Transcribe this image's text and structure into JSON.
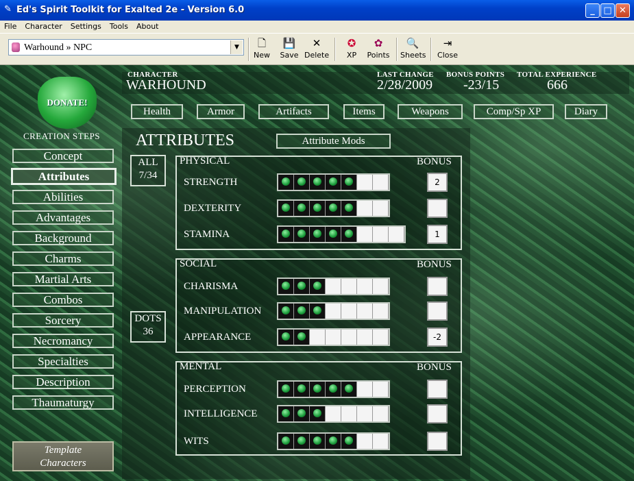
{
  "window": {
    "title": "Ed's Spirit Toolkit for Exalted 2e - Version 6.0",
    "minimize": "_",
    "maximize": "□",
    "close": "✕"
  },
  "menu": [
    "File",
    "Character",
    "Settings",
    "Tools",
    "About"
  ],
  "toolbar": {
    "character_select": "Warhound » NPC",
    "buttons": {
      "new": "New",
      "save": "Save",
      "delete": "Delete",
      "xp": "XP",
      "points": "Points",
      "sheets": "Sheets",
      "close": "Close"
    }
  },
  "sidebar": {
    "donate": "DONATE!",
    "steps_title": "CREATION STEPS",
    "steps": [
      "Concept",
      "Attributes",
      "Abilities",
      "Advantages",
      "Background",
      "Charms",
      "Martial Arts",
      "Combos",
      "Sorcery",
      "Necromancy",
      "Specialties",
      "Description",
      "Thaumaturgy"
    ],
    "active_step": "Attributes",
    "template_line1": "Template",
    "template_line2": "Characters"
  },
  "header": {
    "character_label": "CHARACTER",
    "character_name": "WARHOUND",
    "last_change_label": "LAST CHANGE",
    "last_change": "2/28/2009",
    "bonus_points_label": "BONUS POINTS",
    "bonus_points": "-23/15",
    "total_xp_label": "TOTAL EXPERIENCE",
    "total_xp": "666"
  },
  "tabs": [
    "Health",
    "Armor",
    "Artifacts",
    "Items",
    "Weapons",
    "Comp/Sp XP",
    "Diary"
  ],
  "attributes": {
    "title": "ATTRIBUTES",
    "mods_button": "Attribute Mods",
    "all_label": "ALL",
    "all_value": "7/34",
    "dots_label": "DOTS",
    "dots_value": "36",
    "bonus_label": "BONUS",
    "groups": {
      "physical": {
        "label": "PHYSICAL",
        "items": [
          {
            "name": "STRENGTH",
            "filled": 5,
            "boxes": 7,
            "bonus": "2"
          },
          {
            "name": "DEXTERITY",
            "filled": 5,
            "boxes": 7,
            "bonus": ""
          },
          {
            "name": "STAMINA",
            "filled": 5,
            "boxes": 8,
            "bonus": "1"
          }
        ]
      },
      "social": {
        "label": "SOCIAL",
        "items": [
          {
            "name": "CHARISMA",
            "filled": 3,
            "boxes": 7,
            "bonus": ""
          },
          {
            "name": "MANIPULATION",
            "filled": 3,
            "boxes": 7,
            "bonus": ""
          },
          {
            "name": "APPEARANCE",
            "filled": 2,
            "boxes": 7,
            "bonus": "-2"
          }
        ]
      },
      "mental": {
        "label": "MENTAL",
        "items": [
          {
            "name": "PERCEPTION",
            "filled": 5,
            "boxes": 7,
            "bonus": ""
          },
          {
            "name": "INTELLIGENCE",
            "filled": 3,
            "boxes": 7,
            "bonus": ""
          },
          {
            "name": "WITS",
            "filled": 5,
            "boxes": 7,
            "bonus": ""
          }
        ]
      }
    }
  }
}
